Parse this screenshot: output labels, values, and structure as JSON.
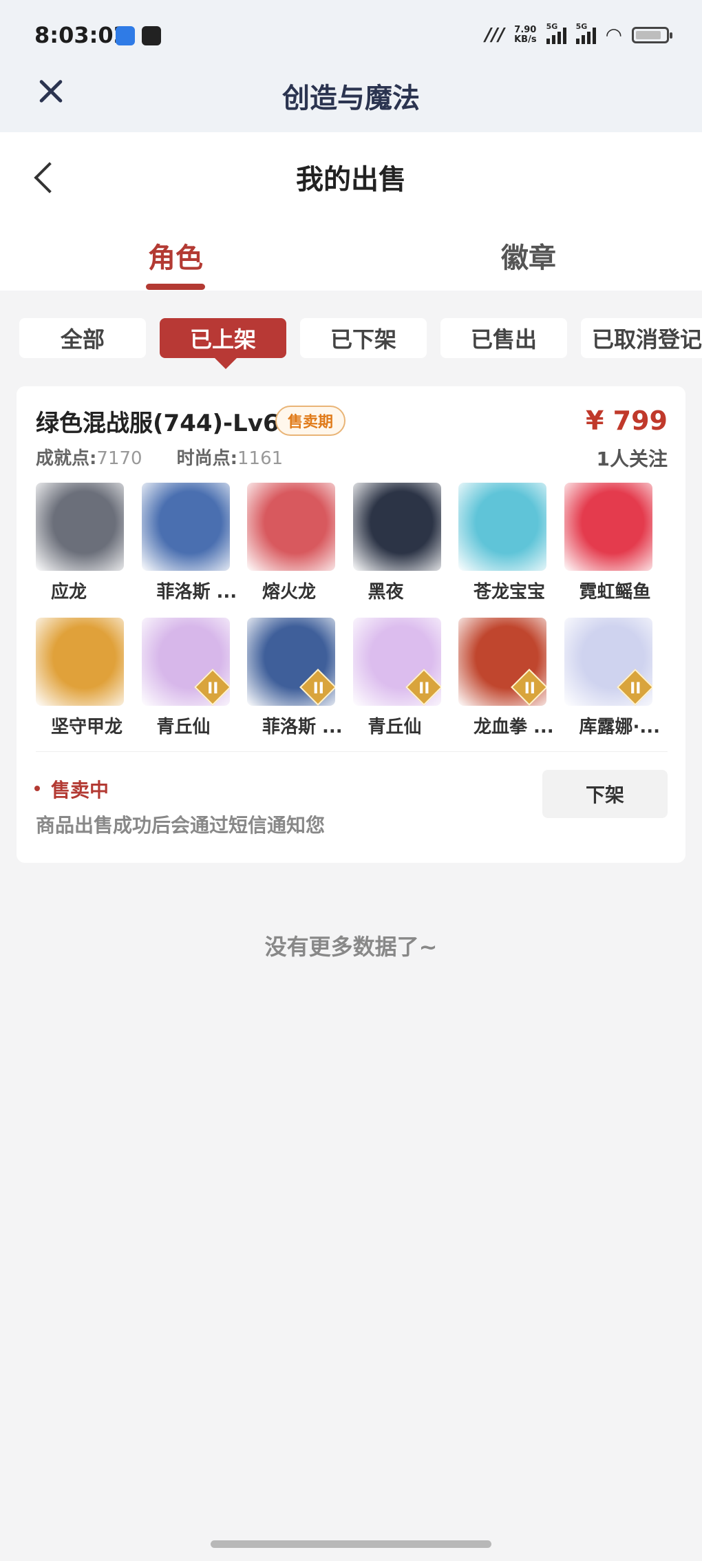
{
  "status_bar": {
    "time": "8:03:02",
    "net_speed_value": "7.90",
    "net_speed_unit": "KB/s",
    "signal_1": "5G",
    "signal_2": "5G"
  },
  "title_bar": {
    "title": "创造与魔法"
  },
  "page": {
    "title": "我的出售",
    "tabs": [
      {
        "label": "角色",
        "active": true
      },
      {
        "label": "徽章",
        "active": false
      }
    ]
  },
  "filters": [
    {
      "label": "全部",
      "active": false
    },
    {
      "label": "已上架",
      "active": true
    },
    {
      "label": "已下架",
      "active": false
    },
    {
      "label": "已售出",
      "active": false
    },
    {
      "label": "已取消登记",
      "active": false
    }
  ],
  "listing": {
    "role_name": "绿色混战服(744)-Lv69",
    "badge": "售卖期",
    "price": "¥ 799",
    "achievement_label": "成就点:",
    "achievement_value": "7170",
    "fashion_label": "时尚点:",
    "fashion_value": "1161",
    "followers": "1人关注",
    "pets": [
      {
        "name": "应龙",
        "color": "#6b6f7a",
        "rank": false
      },
      {
        "name": "菲洛斯 ...",
        "color": "#4a6fb0",
        "rank": false
      },
      {
        "name": "熔火龙",
        "color": "#d8595e",
        "rank": false
      },
      {
        "name": "黑夜",
        "color": "#2c3446",
        "rank": false
      },
      {
        "name": "苍龙宝宝",
        "color": "#5fc4d8",
        "rank": false
      },
      {
        "name": "霓虹鳐鱼",
        "color": "#e43b4d",
        "rank": false
      },
      {
        "name": "坚守甲龙",
        "color": "#e0a13a",
        "rank": false
      },
      {
        "name": "青丘仙",
        "color": "#d7b7ea",
        "rank": true
      },
      {
        "name": "菲洛斯 ...",
        "color": "#3f5f9a",
        "rank": true
      },
      {
        "name": "青丘仙",
        "color": "#dcbdee",
        "rank": true
      },
      {
        "name": "龙血拳 ...",
        "color": "#c0462e",
        "rank": true
      },
      {
        "name": "库露娜·...",
        "color": "#cfd3ef",
        "rank": true
      }
    ],
    "status": "售卖中",
    "notice": "商品出售成功后会通过短信通知您",
    "delist_button": "下架"
  },
  "footer": {
    "no_more": "没有更多数据了~"
  },
  "colors": {
    "accent": "#b83935",
    "title": "#2b3450"
  }
}
